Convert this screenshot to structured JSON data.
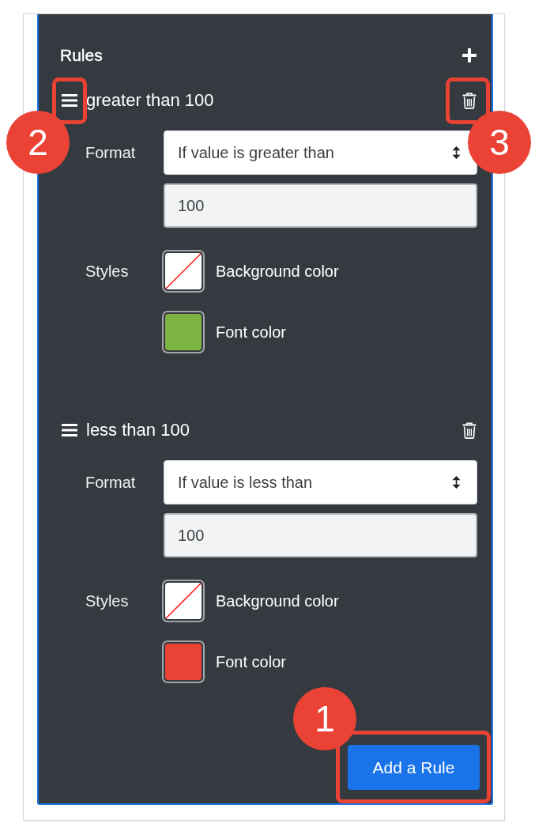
{
  "panel": {
    "title": "Rules"
  },
  "rules": [
    {
      "name": "greater than 100",
      "handle_callout": "2",
      "delete_callout": "3",
      "format_label": "Format",
      "condition": "If value is greater than",
      "value": "100",
      "styles_label": "Styles",
      "styles": [
        {
          "label": "Background color"
        },
        {
          "label": "Font color",
          "color": "#7cb342"
        }
      ]
    },
    {
      "name": "less than 100",
      "format_label": "Format",
      "condition": "If value is less than",
      "value": "100",
      "styles_label": "Styles",
      "styles": [
        {
          "label": "Background color"
        },
        {
          "label": "Font color",
          "color": "#ea4335"
        }
      ]
    }
  ],
  "add_button": {
    "label": "Add a Rule",
    "callout": "1"
  }
}
